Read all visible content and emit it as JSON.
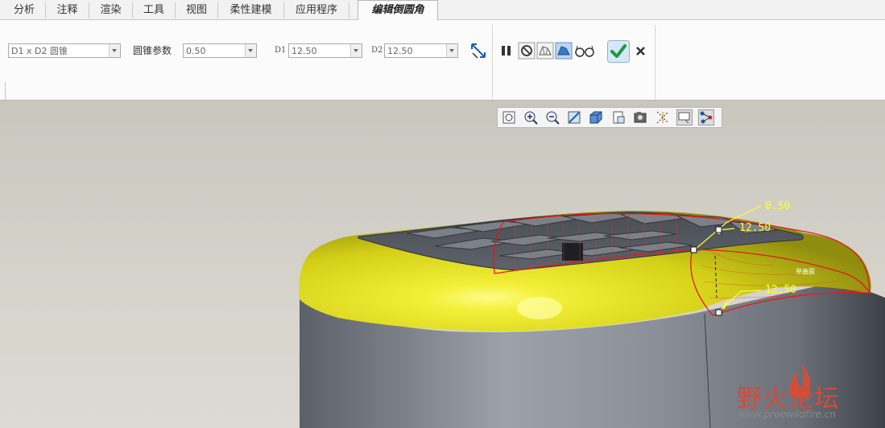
{
  "tabs": [
    {
      "label": "分析"
    },
    {
      "label": "注释"
    },
    {
      "label": "渲染"
    },
    {
      "label": "工具"
    },
    {
      "label": "视图"
    },
    {
      "label": "柔性建模"
    },
    {
      "label": "应用程序"
    },
    {
      "label": "编辑倒圆角"
    }
  ],
  "active_tab_index": 7,
  "ribbon": {
    "shape_select": {
      "value": "D1 x D2 圆锥"
    },
    "conic_param_label": "圆锥参数",
    "conic_param": {
      "value": "0.50"
    },
    "d1_label": "D1",
    "d1": {
      "value": "12.50"
    },
    "d2_label": "D2",
    "d2": {
      "value": "12.50"
    },
    "icons": {
      "flip": "swap-diagonal-icon",
      "pause": "pause-icon",
      "no_preview": "no-preview-icon",
      "geometry_preview": "geometry-preview-icon",
      "feature_preview": "feature-preview-icon",
      "verify": "glasses-icon",
      "ok": "checkmark-icon",
      "cancel": "close-icon"
    },
    "accent_ok": "#2aa84a"
  },
  "view_toolbar": {
    "icons": [
      "refit-icon",
      "zoom-in-icon",
      "zoom-out-icon",
      "repaint-icon",
      "display-style-icon",
      "saved-views-icon",
      "view-manager-icon",
      "datum-display-icon",
      "annotation-display-icon",
      "spin-center-icon"
    ]
  },
  "model": {
    "dimensions": [
      "0.50",
      "12.50",
      "12.50"
    ],
    "surface_label": "单曲面",
    "highlight_color": "#e5e221"
  },
  "watermark": {
    "title": "野火论坛",
    "url": "www.proewildfire.cn"
  }
}
